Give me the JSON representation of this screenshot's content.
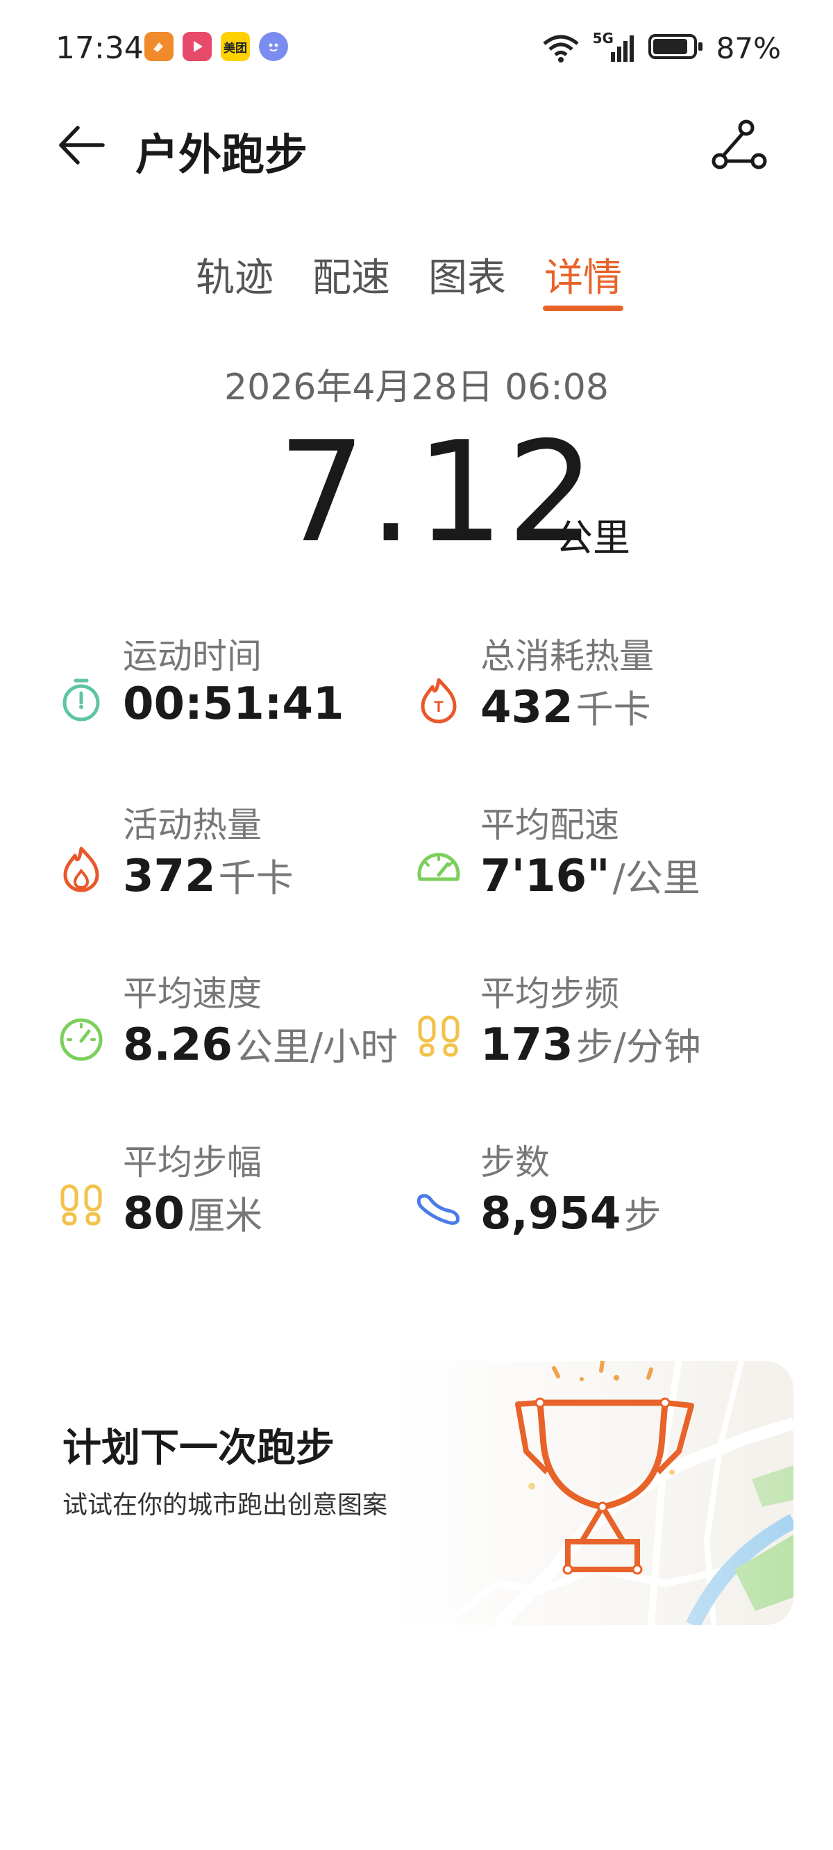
{
  "status_bar": {
    "time": "17:34",
    "apps": [
      {
        "name": "app-orange-icon",
        "color": "#f08a2a"
      },
      {
        "name": "video-app-icon",
        "color": "#e84a6a"
      },
      {
        "name": "meituan-icon",
        "color": "#ffd100",
        "label": "美团"
      },
      {
        "name": "smile-app-icon",
        "color": "#7b8cf0"
      }
    ],
    "network": "5G",
    "battery_percent": "87%",
    "battery_level": 0.87
  },
  "header": {
    "title": "户外跑步"
  },
  "tabs": [
    {
      "label": "轨迹",
      "active": false
    },
    {
      "label": "配速",
      "active": false
    },
    {
      "label": "图表",
      "active": false
    },
    {
      "label": "详情",
      "active": true
    }
  ],
  "summary": {
    "datetime": "2026年4月28日 06:08",
    "distance": "7.12",
    "distance_unit": "公里"
  },
  "stats": [
    {
      "label": "运动时间",
      "value": "00:51:41",
      "unit": "",
      "icon": "stopwatch-icon",
      "color": "#5ec5a0"
    },
    {
      "label": "总消耗热量",
      "value": "432",
      "unit": "千卡",
      "icon": "total-calories-flame-icon",
      "color": "#e8582a"
    },
    {
      "label": "活动热量",
      "value": "372",
      "unit": "千卡",
      "icon": "flame-icon",
      "color": "#e8582a"
    },
    {
      "label": "平均配速",
      "value": "7'16\"",
      "unit": "/公里",
      "icon": "pace-gauge-icon",
      "color": "#7bcf5a"
    },
    {
      "label": "平均速度",
      "value": "8.26",
      "unit": "公里/小时",
      "icon": "speedometer-icon",
      "color": "#7bcf5a"
    },
    {
      "label": "平均步频",
      "value": "173",
      "unit": "步/分钟",
      "icon": "footprints-icon",
      "color": "#f2c24a"
    },
    {
      "label": "平均步幅",
      "value": "80",
      "unit": "厘米",
      "icon": "footprints-icon",
      "color": "#f2c24a"
    },
    {
      "label": "步数",
      "value": "8,954",
      "unit": "步",
      "icon": "shoe-icon",
      "color": "#4a7be8"
    }
  ],
  "promo": {
    "title": "计划下一次跑步",
    "subtitle": "试试在你的城市跑出创意图案",
    "accent": "#e8632a"
  }
}
